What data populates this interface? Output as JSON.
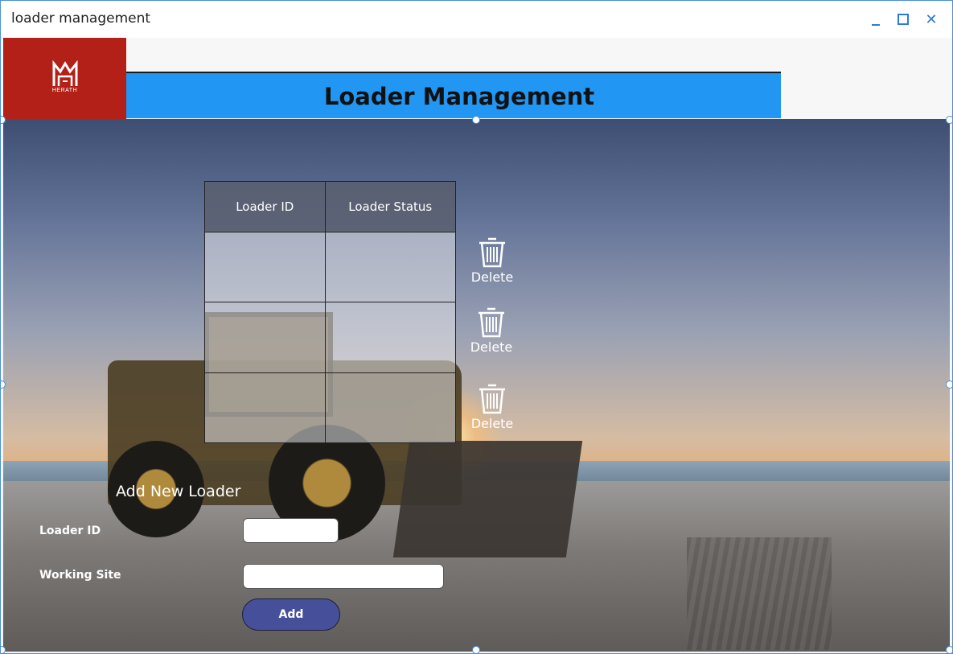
{
  "window": {
    "title": "loader management",
    "minimize_icon": "minimize-icon",
    "maximize_icon": "maximize-icon",
    "close_icon": "close-icon",
    "close_glyph": "✕"
  },
  "brand": {
    "logo_name": "HERATH",
    "logo_icon": "herath-logo-icon",
    "color": "#b32018"
  },
  "header": {
    "title": "Loader Management",
    "color": "#2196f3"
  },
  "table": {
    "columns": [
      "Loader ID",
      "Loader Status"
    ],
    "rows": [
      [
        "",
        ""
      ],
      [
        "",
        ""
      ],
      [
        "",
        ""
      ]
    ]
  },
  "row_actions": [
    {
      "icon": "trash-icon",
      "label": "Delete"
    },
    {
      "icon": "trash-icon",
      "label": "Delete"
    },
    {
      "icon": "trash-icon",
      "label": "Delete"
    }
  ],
  "form": {
    "title": "Add New Loader",
    "loader_id_label": "Loader ID",
    "loader_id_value": "",
    "working_site_label": "Working Site",
    "working_site_value": "",
    "add_label": "Add",
    "add_color": "#46509a"
  }
}
